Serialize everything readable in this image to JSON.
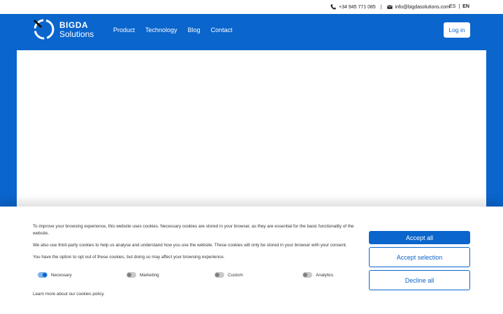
{
  "topbar": {
    "phone": "+34 945 771 085",
    "separator": "|",
    "email": "info@bigdasolutions.com",
    "lang_es": "ES",
    "lang_sep": "|",
    "lang_en": "EN",
    "icons": [
      "phone-icon",
      "envelope-icon"
    ]
  },
  "header": {
    "logo_line1": "BIGDA",
    "logo_line2": "Solutions",
    "nav": [
      "Product",
      "Technology",
      "Blog",
      "Contact"
    ],
    "login_label": "Log in"
  },
  "cookies": {
    "paragraph1": "To improve your browsing experience, this website uses cookies. Necessary cookies are stored in your browser, as they are essential for the basic functionality of the website.",
    "paragraph2": "We also use third-party cookies to help us analyse and understand how you use the website. These cookies will only be stored in your browser with your consent.",
    "paragraph3": "You have the option to opt out of these cookies, but doing so may affect your browsing experience.",
    "toggles": [
      {
        "label": "Necessary",
        "on": true
      },
      {
        "label": "Marketing",
        "on": false
      },
      {
        "label": "Custom",
        "on": false
      },
      {
        "label": "Analytics",
        "on": false
      }
    ],
    "policy_link": "Learn more about our cookies policy.",
    "accept_all": "Accept all",
    "accept_selection": "Accept selection",
    "decline_all": "Decline all"
  },
  "colors": {
    "brand_blue": "#0a65cc",
    "white": "#ffffff"
  }
}
